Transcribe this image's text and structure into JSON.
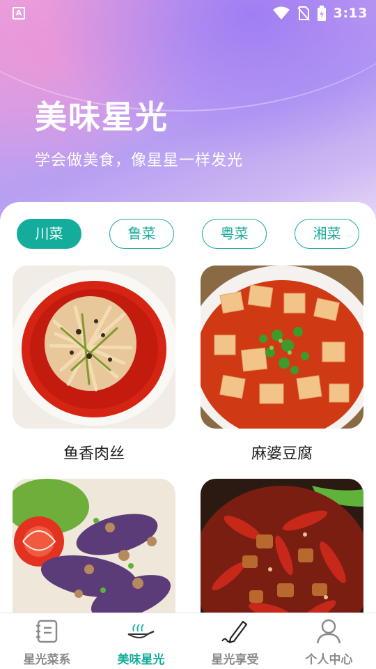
{
  "status_bar": {
    "app_badge": "A",
    "time": "3:13",
    "icons": [
      "wifi-icon",
      "no-sim-icon",
      "battery-charging-icon"
    ]
  },
  "hero": {
    "title": "美味星光",
    "subtitle": "学会做美食，像星星一样发光"
  },
  "tabs": [
    {
      "label": "川菜",
      "active": true
    },
    {
      "label": "鲁菜",
      "active": false
    },
    {
      "label": "粤菜",
      "active": false
    },
    {
      "label": "湘菜",
      "active": false
    }
  ],
  "dishes": [
    {
      "name": "鱼香肉丝"
    },
    {
      "name": "麻婆豆腐"
    },
    {
      "name": "",
      "partially_visible": true
    },
    {
      "name": "",
      "partially_visible": true
    }
  ],
  "bottom_nav": [
    {
      "label": "星光菜系",
      "icon": "cookbook-icon",
      "active": false
    },
    {
      "label": "美味星光",
      "icon": "frying-pan-icon",
      "active": true
    },
    {
      "label": "星光享受",
      "icon": "pen-icon",
      "active": false
    },
    {
      "label": "个人中心",
      "icon": "person-icon",
      "active": false
    }
  ],
  "colors": {
    "accent": "#14ad9c",
    "nav_inactive": "#8a8a8a",
    "hero_gradient": [
      "#e9a6dc",
      "#b79ff2",
      "#e9dcf8"
    ]
  }
}
